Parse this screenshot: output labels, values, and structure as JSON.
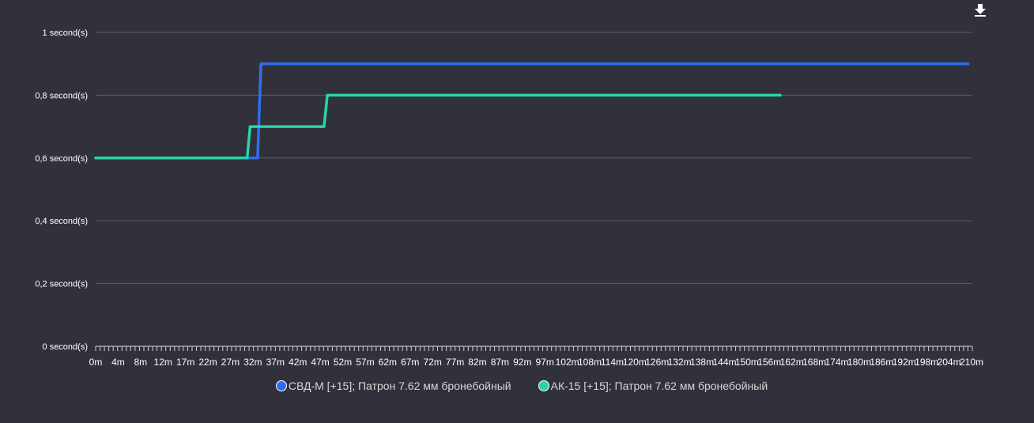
{
  "toolbar": {
    "download_icon": "download-icon"
  },
  "colors": {
    "background": "#31313b",
    "grid": "#5f5f68"
  },
  "chart_data": {
    "type": "line",
    "step": true,
    "x_unit": "m",
    "y_unit": "second(s)",
    "ylim": [
      0,
      1
    ],
    "xlim": [
      0,
      210
    ],
    "y_ticks": [
      "0 second(s)",
      "0,2 second(s)",
      "0,4 second(s)",
      "0,6 second(s)",
      "0,8 second(s)",
      "1 second(s)"
    ],
    "y_tick_values": [
      0,
      0.2,
      0.4,
      0.6,
      0.8,
      1
    ],
    "x_ticks": [
      "0m",
      "4m",
      "8m",
      "12m",
      "17m",
      "22m",
      "27m",
      "32m",
      "37m",
      "42m",
      "47m",
      "52m",
      "57m",
      "62m",
      "67m",
      "72m",
      "77m",
      "82m",
      "87m",
      "92m",
      "97m",
      "102m",
      "108m",
      "114m",
      "120m",
      "126m",
      "132m",
      "138m",
      "144m",
      "150m",
      "156m",
      "162m",
      "168m",
      "174m",
      "180m",
      "186m",
      "192m",
      "198m",
      "204m",
      "210m"
    ],
    "grid": true,
    "legend": "bottom-center",
    "series": [
      {
        "name": "СВД-М [+15]; Патрон 7.62 мм бронебойный",
        "color": "#2e6ff2",
        "points": [
          [
            0,
            0.6
          ],
          [
            38.8,
            0.6
          ],
          [
            39.6,
            0.9
          ],
          [
            209,
            0.9
          ]
        ]
      },
      {
        "name": "АК-15 [+15]; Патрон 7.62 мм бронебойный",
        "color": "#26d6a8",
        "points": [
          [
            0,
            0.6
          ],
          [
            36.3,
            0.6
          ],
          [
            37.0,
            0.7
          ],
          [
            54.7,
            0.7
          ],
          [
            55.5,
            0.8
          ],
          [
            164,
            0.8
          ]
        ]
      }
    ]
  }
}
